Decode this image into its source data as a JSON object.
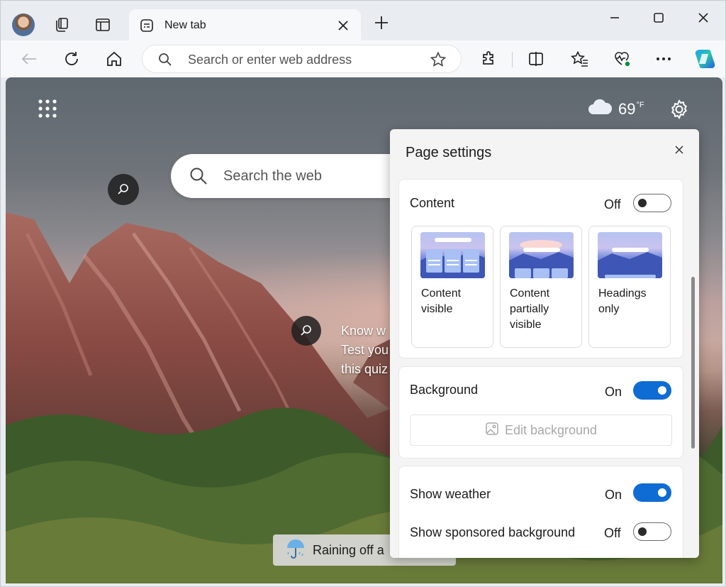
{
  "tab": {
    "title": "New tab"
  },
  "toolbar": {
    "address_placeholder": "Search or enter web address"
  },
  "page": {
    "search_placeholder": "Search the web",
    "weather": {
      "temp": "69",
      "unit": "°F"
    },
    "quiz_lines": [
      "Know w",
      "Test you",
      "this quiz"
    ],
    "rain_banner": "Raining off a"
  },
  "panel": {
    "title": "Page settings",
    "content": {
      "label": "Content",
      "state": "Off",
      "options": [
        {
          "label": "Content\nvisible"
        },
        {
          "label": "Content\npartially\nvisible"
        },
        {
          "label": "Headings\nonly"
        }
      ]
    },
    "background": {
      "label": "Background",
      "state": "On",
      "edit_label": "Edit background"
    },
    "weather": {
      "label": "Show weather",
      "state": "On"
    },
    "sponsored": {
      "label": "Show sponsored background",
      "state": "Off"
    }
  },
  "colors": {
    "accent": "#0f6cd4",
    "toggle_off_knob": "#2b2b2b"
  }
}
